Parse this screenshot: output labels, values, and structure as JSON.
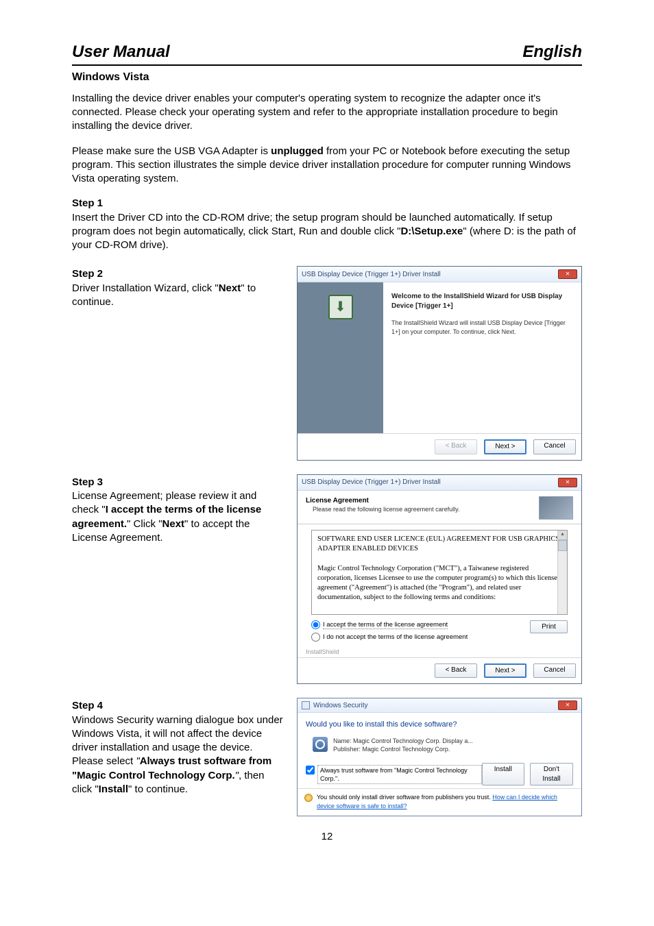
{
  "header": {
    "left": "User Manual",
    "right": "English"
  },
  "section_title": "Windows Vista",
  "para1": "Installing the device driver enables your computer's operating system to recognize the adapter once it's connected. Please check your operating system and refer to the appropriate installation procedure to begin installing the device driver.",
  "para2_a": "Please make sure the USB VGA Adapter is ",
  "para2_b": "unplugged",
  "para2_c": " from your PC or Notebook before executing the setup program. This section illustrates the simple device driver installation procedure for computer running Windows Vista operating system.",
  "step1": {
    "label": "Step 1",
    "text_a": "Insert the Driver CD into the CD-ROM drive; the setup program should be launched automatically. If setup program does not begin automatically, click Start, Run and double click \"",
    "text_b": "D:\\Setup.exe",
    "text_c": "\" (where D: is the path of your CD-ROM drive)."
  },
  "step2": {
    "label": "Step 2",
    "text_a": "Driver Installation Wizard, click \"",
    "text_b": "Next",
    "text_c": "\" to continue.",
    "dialog": {
      "title": "USB Display Device (Trigger 1+) Driver Install",
      "welcome": "Welcome to the InstallShield Wizard for USB Display Device [Trigger 1+]",
      "desc": "The InstallShield Wizard will install USB Display Device [Trigger 1+] on your computer. To continue, click Next.",
      "back": "< Back",
      "next": "Next >",
      "cancel": "Cancel"
    }
  },
  "step3": {
    "label": "Step 3",
    "text_a": "License Agreement; please review it and check \"",
    "text_b": "I accept the terms of the license agreement.",
    "text_c": "\" Click \"",
    "text_d": "Next",
    "text_e": "\" to accept the License Agreement.",
    "dialog": {
      "title": "USB Display Device (Trigger 1+) Driver Install",
      "la_title": "License Agreement",
      "la_sub": "Please read the following license agreement carefully.",
      "lic1": "SOFTWARE END USER LICENCE (EUL) AGREEMENT FOR USB GRAPHICS ADAPTER ENABLED DEVICES",
      "lic2": "Magic Control Technology Corporation (\"MCT\"), a Taiwanese registered corporation, licenses Licensee to use the computer program(s) to which this license agreement (\"Agreement\") is attached (the \"Program\"), and related user documentation, subject to the following terms and conditions:",
      "accept": "I accept the terms of the license agreement",
      "reject": "I do not accept the terms of the license agreement",
      "print": "Print",
      "ishield": "InstallShield",
      "back": "< Back",
      "next": "Next >",
      "cancel": "Cancel"
    }
  },
  "step4": {
    "label": "Step 4",
    "text_a": "Windows Security warning dialogue box under Windows Vista, it will not affect the device driver installation and usage the device. Please select ",
    "text_b": "\"",
    "text_c": "Always trust software from \"Magic Control Technology Corp.",
    "text_d": "\"",
    "text_e": ", then click \"",
    "text_f": "Install",
    "text_g": "\" to continue.",
    "dialog": {
      "title": "Windows Security",
      "question": "Would you like to install this device software?",
      "name_line": "Name: Magic Control Technology Corp. Display a...",
      "pub_line": "Publisher: Magic Control Technology Corp.",
      "trust": "Always trust software from \"Magic Control Technology Corp.\".",
      "install": "Install",
      "dont": "Don't Install",
      "note_a": "You should only install driver software from publishers you trust. ",
      "note_link": "How can I decide which device software is safe to install?"
    }
  },
  "page_number": "12"
}
